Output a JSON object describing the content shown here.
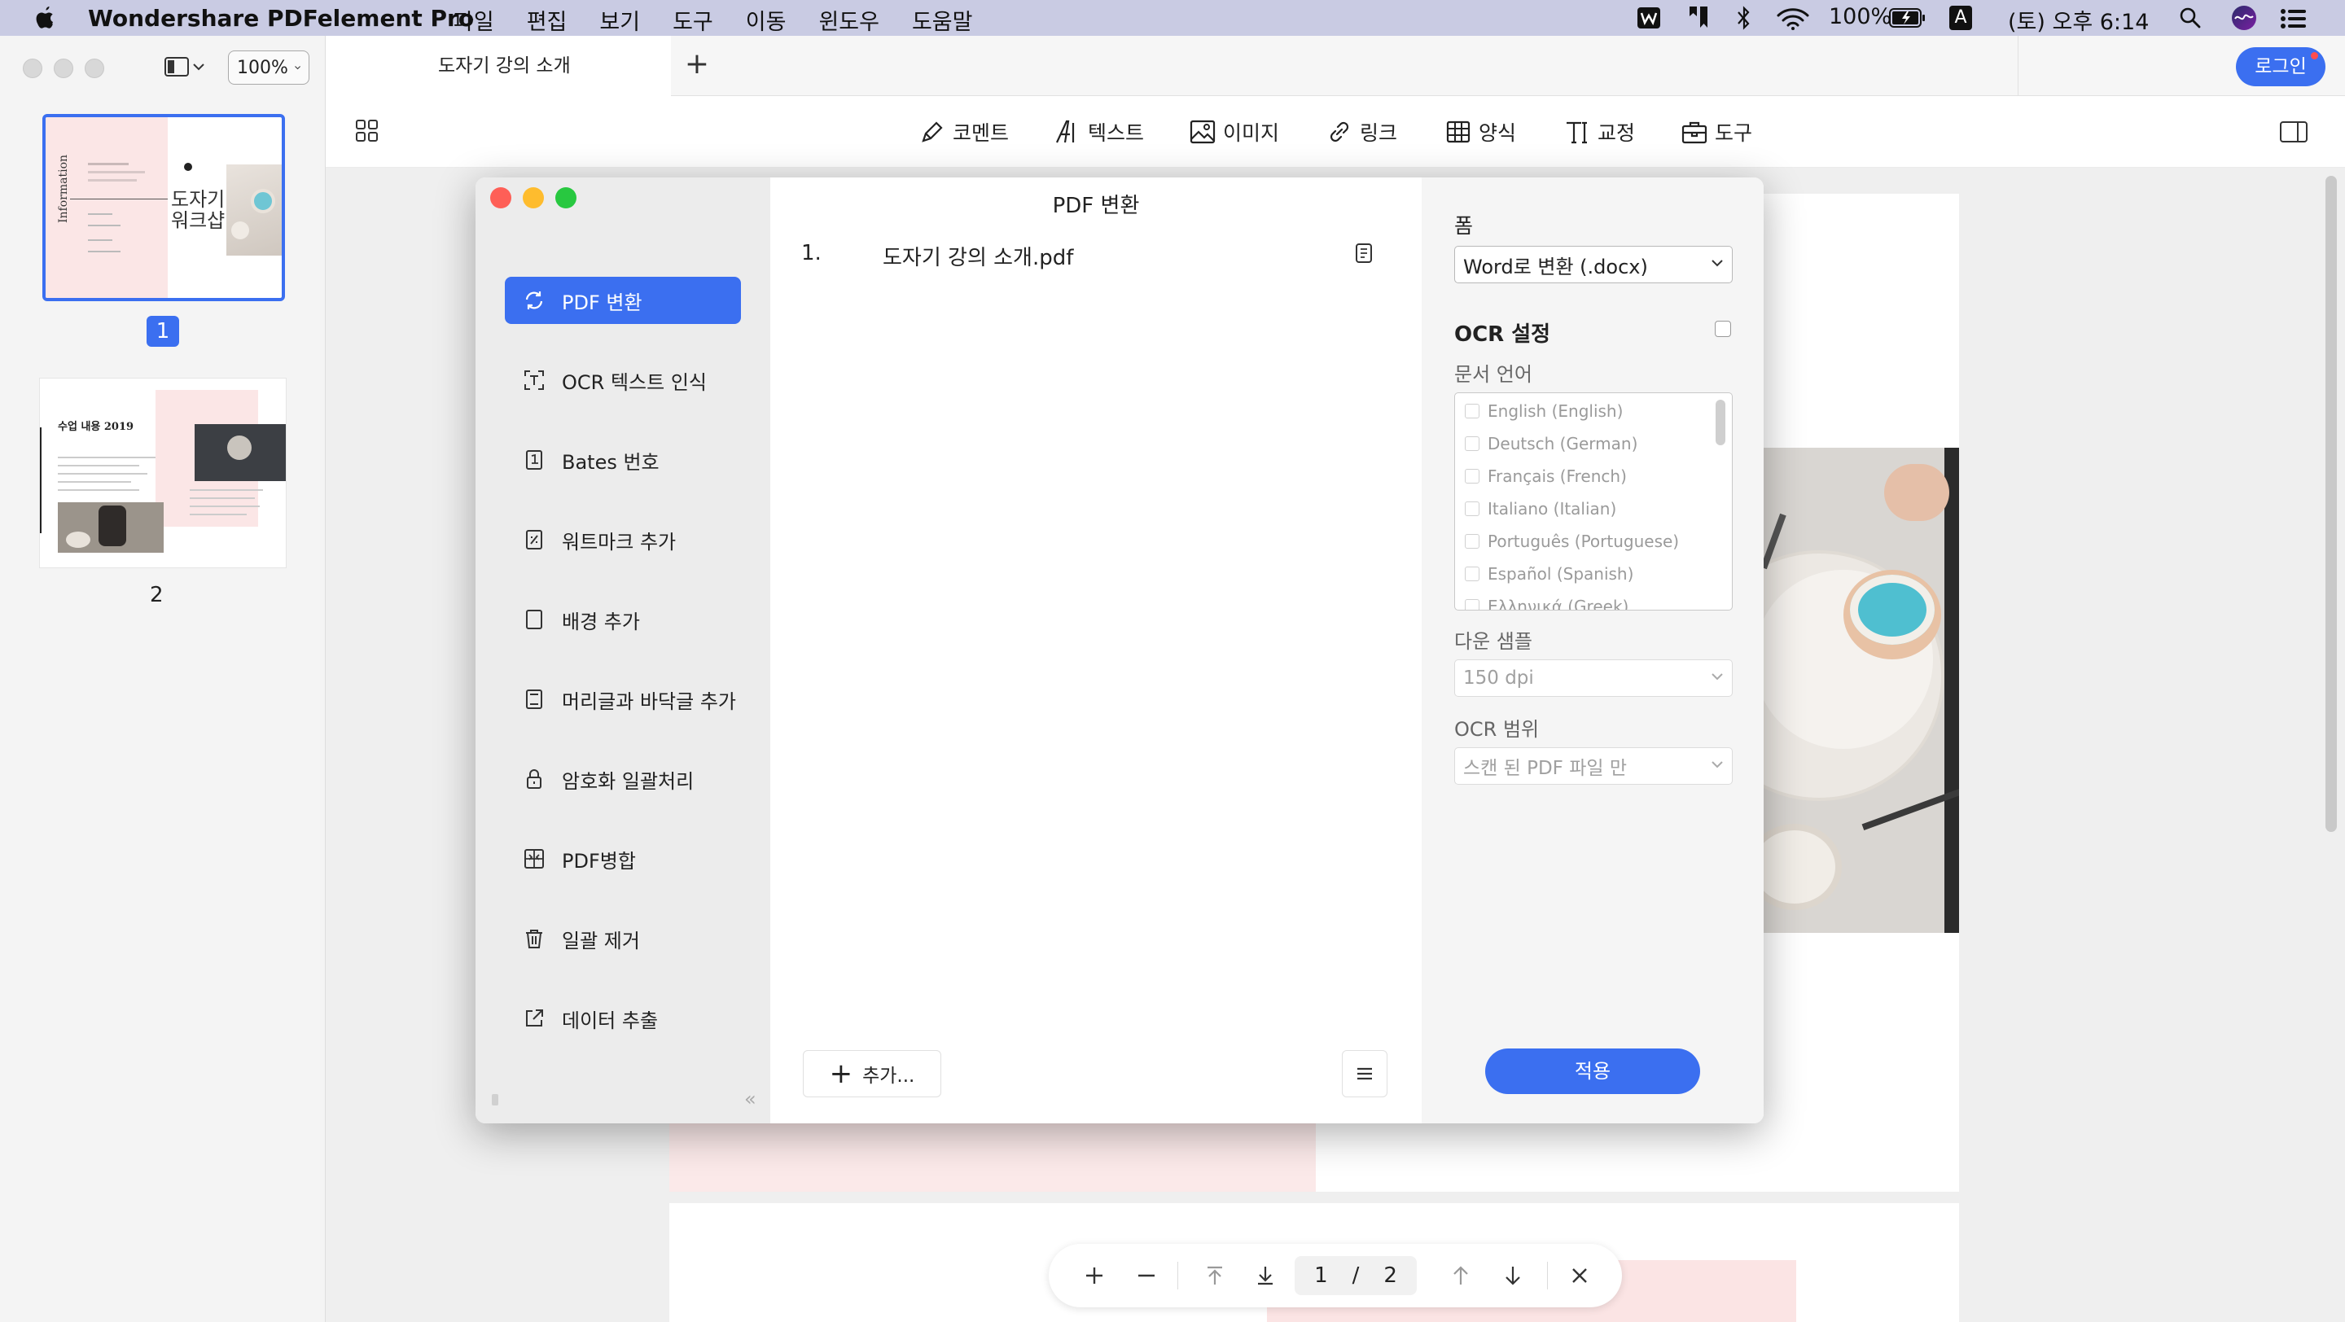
{
  "menubar": {
    "app_name": "Wondershare PDFelement Pro",
    "menus": [
      "파일",
      "편집",
      "보기",
      "도구",
      "이동",
      "윈도우",
      "도움말"
    ],
    "battery": "100%",
    "input_source": "A",
    "clock": "(토) 오후 6:14"
  },
  "sidebar": {
    "zoom": "100%",
    "pages": [
      {
        "number": "1",
        "selected": true
      },
      {
        "number": "2",
        "selected": false
      }
    ],
    "thumb1": {
      "side_text": "Information",
      "title_line1": "도자기",
      "title_line2": "워크샵"
    },
    "thumb2": {
      "title": "수업 내용 2019"
    }
  },
  "tabs": {
    "active_title": "도자기 강의 소개",
    "new_tab": "+",
    "login": "로그인"
  },
  "toolbar": {
    "items": [
      "코멘트",
      "텍스트",
      "이미지",
      "링크",
      "양식",
      "교정",
      "도구"
    ]
  },
  "dialog": {
    "title": "PDF 변환",
    "nav": [
      {
        "label": "PDF 변환",
        "icon": "convert-icon",
        "active": true
      },
      {
        "label": "OCR 텍스트 인식",
        "icon": "ocr-icon",
        "active": false
      },
      {
        "label": "Bates 번호",
        "icon": "bates-icon",
        "active": false
      },
      {
        "label": "워트마크 추가",
        "icon": "watermark-icon",
        "active": false
      },
      {
        "label": "배경 추가",
        "icon": "background-icon",
        "active": false
      },
      {
        "label": "머리글과 바닥글 추가",
        "icon": "header-footer-icon",
        "active": false
      },
      {
        "label": "암호화 일괄처리",
        "icon": "lock-icon",
        "active": false
      },
      {
        "label": "PDF병합",
        "icon": "merge-icon",
        "active": false
      },
      {
        "label": "일괄 제거",
        "icon": "trash-icon",
        "active": false
      },
      {
        "label": "데이터 추출",
        "icon": "extract-icon",
        "active": false
      }
    ],
    "files": [
      {
        "index": "1.",
        "name": "도자기 강의 소개.pdf"
      }
    ],
    "add_button": "추가...",
    "settings": {
      "form_label": "폼",
      "format_value": "Word로 변환 (.docx)",
      "ocr_title": "OCR 설정",
      "ocr_enabled": false,
      "doc_lang_label": "문서 언어",
      "languages": [
        "English (English)",
        "Deutsch (German)",
        "Français (French)",
        "Italiano (Italian)",
        "Português (Portuguese)",
        "Español (Spanish)",
        "Ελληνικά (Greek)"
      ],
      "downsample_label": "다운 샘플",
      "downsample_value": "150 dpi",
      "ocr_range_label": "OCR 범위",
      "ocr_range_value": "스캔 된 PDF 파일 만"
    },
    "apply": "적용"
  },
  "pagenav": {
    "current": "1",
    "separator": "/",
    "total": "2"
  },
  "colors": {
    "accent": "#3b6ff0",
    "menubar": "#c9cbe3",
    "close": "#fe5f57",
    "minimize": "#febc2e",
    "zoom": "#28c840"
  }
}
